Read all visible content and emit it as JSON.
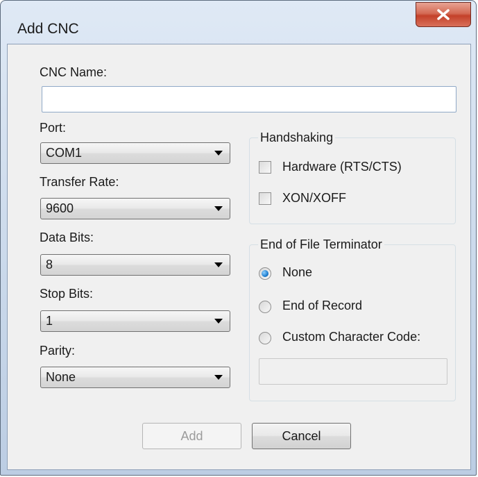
{
  "window": {
    "title": "Add CNC"
  },
  "form": {
    "cnc_name": {
      "label": "CNC Name:",
      "value": ""
    },
    "port": {
      "label": "Port:",
      "value": "COM1"
    },
    "transfer_rate": {
      "label": "Transfer Rate:",
      "value": "9600"
    },
    "data_bits": {
      "label": "Data Bits:",
      "value": "8"
    },
    "stop_bits": {
      "label": "Stop Bits:",
      "value": "1"
    },
    "parity": {
      "label": "Parity:",
      "value": "None"
    }
  },
  "handshaking": {
    "title": "Handshaking",
    "options": [
      {
        "label": "Hardware (RTS/CTS)",
        "checked": false
      },
      {
        "label": "XON/XOFF",
        "checked": false
      }
    ]
  },
  "eof_terminator": {
    "title": "End of File Terminator",
    "options": [
      {
        "label": "None",
        "selected": true
      },
      {
        "label": "End of Record",
        "selected": false
      },
      {
        "label": "Custom Character Code:",
        "selected": false
      }
    ],
    "custom_code_value": ""
  },
  "buttons": {
    "add": "Add",
    "cancel": "Cancel"
  }
}
